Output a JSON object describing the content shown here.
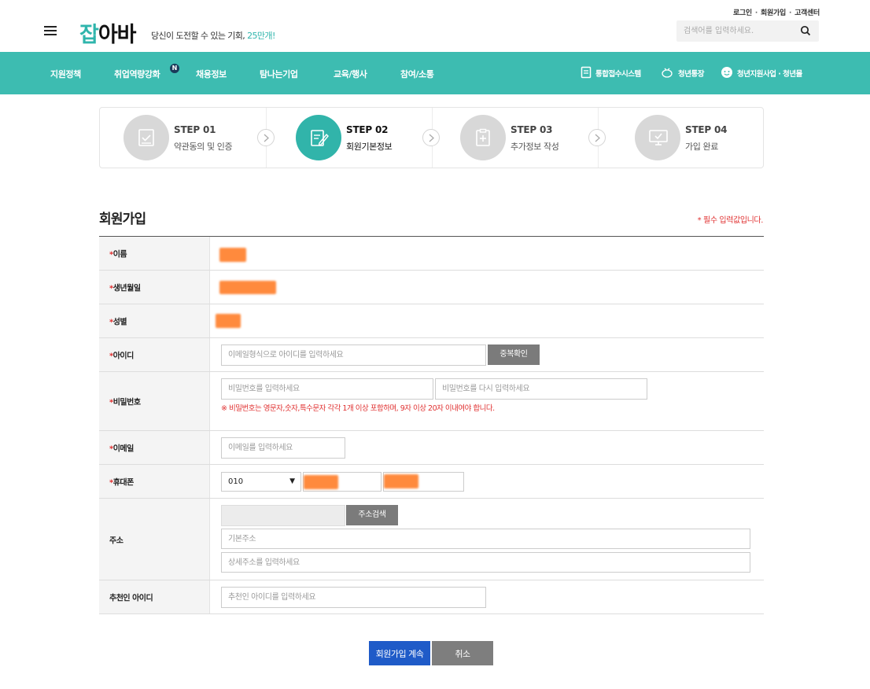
{
  "header": {
    "top_links": [
      "로그인",
      "회원가입",
      "고객센터"
    ],
    "logo_part1": "잡",
    "logo_part2": "아바",
    "tagline_text": "당신이 도전할 수 있는 기회, ",
    "tagline_highlight": "25만개!",
    "search_placeholder": "검색어를 입력하세요."
  },
  "nav": {
    "items": [
      "지원정책",
      "취업역량강화",
      "채용정보",
      "탐나는기업",
      "교육/행사",
      "참여/소통"
    ],
    "badge": "N",
    "right_items": [
      "통합접수시스템",
      "청년통장",
      "청년지원사업 · 청년몰"
    ]
  },
  "steps": [
    {
      "num": "STEP 01",
      "label": "약관동의 및 인증",
      "icon": "document-check-icon"
    },
    {
      "num": "STEP 02",
      "label": "회원기본정보",
      "icon": "edit-form-icon"
    },
    {
      "num": "STEP 03",
      "label": "추가정보 작성",
      "icon": "clipboard-plus-icon"
    },
    {
      "num": "STEP 04",
      "label": "가입 완료",
      "icon": "monitor-check-icon"
    }
  ],
  "form": {
    "title": "회원가입",
    "required_note": "* 필수 입력값입니다.",
    "rows": {
      "name": {
        "label": "이름"
      },
      "birth": {
        "label": "생년월일"
      },
      "gender": {
        "label": "성별"
      },
      "id": {
        "label": "아이디",
        "placeholder": "이메일형식으로 아이디를 입력하세요",
        "button": "중복확인"
      },
      "password": {
        "label": "비밀번호",
        "placeholder1": "비밀번호를 입력하세요",
        "placeholder2": "비밀번호를 다시 입력하세요",
        "warning": "※ 비밀번호는 영문자,숫자,특수문자 각각 1개 이상 포함하며, 9자 이상 20자 이내여야 합니다."
      },
      "email": {
        "label": "이메일",
        "placeholder": "이메일를 입력하세요"
      },
      "phone": {
        "label": "휴대폰",
        "prefix": "010"
      },
      "address": {
        "label": "주소",
        "button": "주소검색",
        "placeholder1": "기본주소",
        "placeholder2": "상세주소를 입력하세요"
      },
      "referrer": {
        "label": "추천인 아이디",
        "placeholder": "추천인 아이디를 입력하세요"
      }
    },
    "required_mark": "*",
    "submit_label": "회원가입 계속",
    "cancel_label": "취소"
  },
  "colors": {
    "accent": "#3dbcb1",
    "submit": "#1f5bc8",
    "required": "#e03131"
  }
}
